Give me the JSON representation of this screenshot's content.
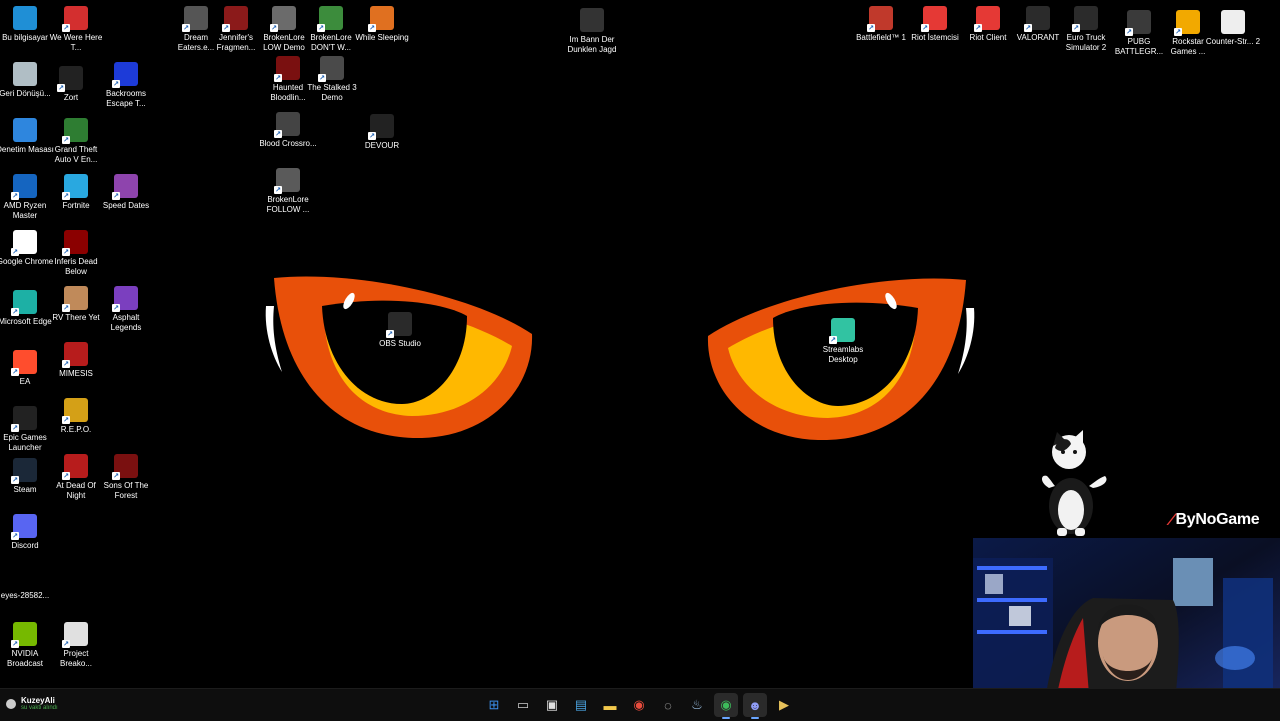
{
  "wallpaper": {
    "colors": {
      "iris_outer": "#e8500a",
      "iris_inner": "#ffb800",
      "pupil": "#000000",
      "highlight": "#ffffff"
    }
  },
  "desktop_icons": [
    {
      "label": "Bu bilgisayar",
      "icon": "monitor-icon",
      "color": "#1f8fd6"
    },
    {
      "label": "We Were Here T...",
      "icon": "game-icon",
      "color": "#d32f2f"
    },
    {
      "label": "Dream Eaters.e...",
      "icon": "game-icon",
      "color": "#555555"
    },
    {
      "label": "Jennifer's Fragmen...",
      "icon": "game-icon",
      "color": "#8b1a1a"
    },
    {
      "label": "BrokenLore LOW Demo",
      "icon": "game-icon",
      "color": "#6b6b6b"
    },
    {
      "label": "BrokenLore DON'T W...",
      "icon": "game-icon",
      "color": "#3c8c3c"
    },
    {
      "label": "While Sleeping",
      "icon": "game-icon",
      "color": "#e07020"
    },
    {
      "label": "Im Bann Der Dunklen Jagd",
      "icon": "question-icon",
      "color": "#333333"
    },
    {
      "label": "Battlefield™ 1",
      "icon": "game-icon",
      "color": "#c0392b"
    },
    {
      "label": "Riot İstemcisi",
      "icon": "riot-icon",
      "color": "#e53935"
    },
    {
      "label": "Riot Client",
      "icon": "riot-icon",
      "color": "#e53935"
    },
    {
      "label": "VALORANT",
      "icon": "valorant-icon",
      "color": "#2b2b2b"
    },
    {
      "label": "Euro Truck Simulator 2",
      "icon": "truck-icon",
      "color": "#2b2b2b"
    },
    {
      "label": "PUBG BATTLEGR...",
      "icon": "pubg-icon",
      "color": "#3a3a3a"
    },
    {
      "label": "Rockstar Games ...",
      "icon": "rockstar-icon",
      "color": "#f2a900"
    },
    {
      "label": "Counter-Str... 2",
      "icon": "file-icon",
      "color": "#eeeeee"
    },
    {
      "label": "Geri Dönüşü...",
      "icon": "recycle-bin-icon",
      "color": "#b0bec5"
    },
    {
      "label": "Zort",
      "icon": "game-icon",
      "color": "#222222"
    },
    {
      "label": "Backrooms Escape T...",
      "icon": "game-icon",
      "color": "#1d3bd8"
    },
    {
      "label": "Haunted Bloodlin...",
      "icon": "game-icon",
      "color": "#7a1010"
    },
    {
      "label": "The Stalked 3 Demo",
      "icon": "game-icon",
      "color": "#4a4a4a"
    },
    {
      "label": "Denetim Masası",
      "icon": "control-panel-icon",
      "color": "#2e86de"
    },
    {
      "label": "Grand Theft Auto V En...",
      "icon": "gta-icon",
      "color": "#2e7d32"
    },
    {
      "label": "Blood Crossro...",
      "icon": "game-icon",
      "color": "#444444"
    },
    {
      "label": "DEVOUR",
      "icon": "devour-icon",
      "color": "#222222"
    },
    {
      "label": "AMD Ryzen Master",
      "icon": "amd-icon",
      "color": "#1565c0"
    },
    {
      "label": "Fortnite",
      "icon": "fortnite-icon",
      "color": "#29a8e0"
    },
    {
      "label": "Speed Dates",
      "icon": "game-icon",
      "color": "#8e44ad"
    },
    {
      "label": "BrokenLore FOLLOW ...",
      "icon": "game-icon",
      "color": "#5a5a5a"
    },
    {
      "label": "Google Chrome",
      "icon": "chrome-icon",
      "color": "#ffffff"
    },
    {
      "label": "Inferis Dead Below",
      "icon": "game-icon",
      "color": "#8b0000"
    },
    {
      "label": "Microsoft Edge",
      "icon": "edge-icon",
      "color": "#1db0a5"
    },
    {
      "label": "RV There Yet",
      "icon": "game-icon",
      "color": "#c08a5a"
    },
    {
      "label": "Asphalt Legends",
      "icon": "asphalt-icon",
      "color": "#7b3fbf"
    },
    {
      "label": "OBS Studio",
      "icon": "obs-icon",
      "color": "#2a2a2a"
    },
    {
      "label": "Streamlabs Desktop",
      "icon": "streamlabs-icon",
      "color": "#31c3a2"
    },
    {
      "label": "EA",
      "icon": "ea-icon",
      "color": "#ff4d2d"
    },
    {
      "label": "MIMESIS",
      "icon": "game-icon",
      "color": "#b71c1c"
    },
    {
      "label": "Epic Games Launcher",
      "icon": "epic-icon",
      "color": "#222222"
    },
    {
      "label": "R.E.P.O.",
      "icon": "repo-icon",
      "color": "#d4a017"
    },
    {
      "label": "Steam",
      "icon": "steam-icon",
      "color": "#1b2838"
    },
    {
      "label": "At Dead Of Night",
      "icon": "game-icon",
      "color": "#b71c1c"
    },
    {
      "label": "Sons Of The Forest",
      "icon": "game-icon",
      "color": "#7a1010"
    },
    {
      "label": "Discord",
      "icon": "discord-icon",
      "color": "#5865f2"
    },
    {
      "label": "eyes-28582...",
      "icon": "image-icon",
      "color": "#000000"
    },
    {
      "label": "NVIDIA Broadcast",
      "icon": "nvidia-icon",
      "color": "#76b900"
    },
    {
      "label": "Project Breako...",
      "icon": "game-icon",
      "color": "#e0e0e0"
    }
  ],
  "overlays": {
    "brand": "ByNoGame"
  },
  "taskbar": {
    "user_name": "KuzeyAli",
    "user_status": "su vakti alındı",
    "apps": [
      {
        "name": "start",
        "glyph": "⊞",
        "color": "#3b8eea",
        "active": false
      },
      {
        "name": "task-view",
        "glyph": "▭",
        "color": "#cccccc",
        "active": false
      },
      {
        "name": "app-red",
        "glyph": "▣",
        "color": "#e0e0e0",
        "active": false
      },
      {
        "name": "app-blue",
        "glyph": "▤",
        "color": "#4aa3df",
        "active": false
      },
      {
        "name": "file-explorer",
        "glyph": "▬",
        "color": "#f2c94c",
        "active": false
      },
      {
        "name": "chrome",
        "glyph": "◉",
        "color": "#e84c3d",
        "active": false
      },
      {
        "name": "app-circle",
        "glyph": "◌",
        "color": "#dddddd",
        "active": false
      },
      {
        "name": "steam",
        "glyph": "♨",
        "color": "#9fc4e8",
        "active": false
      },
      {
        "name": "chrome-2",
        "glyph": "◉",
        "color": "#3dbb5a",
        "active": true
      },
      {
        "name": "discord",
        "glyph": "☻",
        "color": "#8f9cf5",
        "active": true
      },
      {
        "name": "app-yellow",
        "glyph": "▶",
        "color": "#e6c15a",
        "active": false
      }
    ]
  }
}
